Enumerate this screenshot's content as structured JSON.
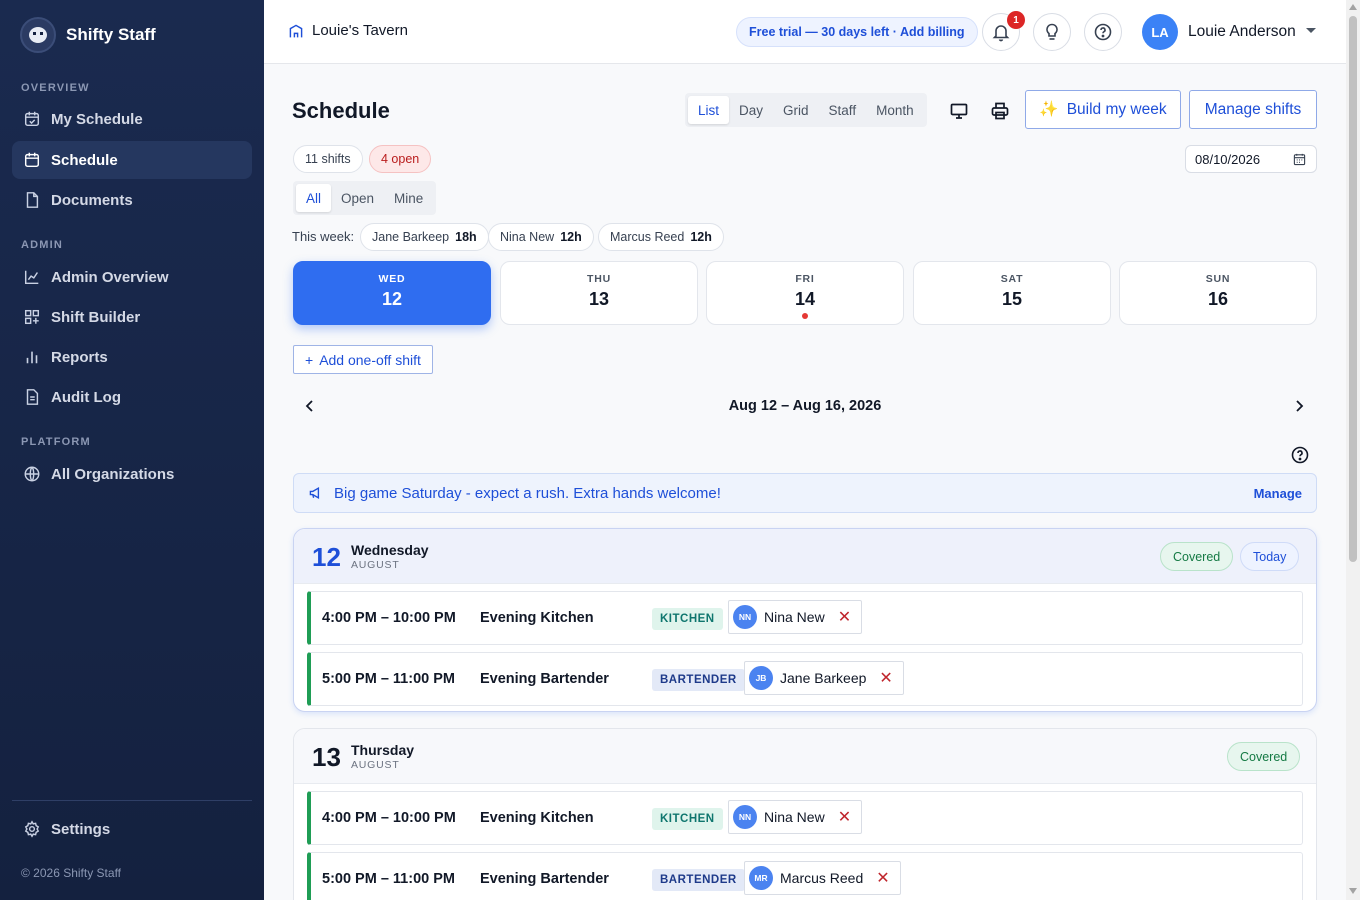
{
  "sidebar": {
    "brand": "Shifty Staff",
    "sections": {
      "overview": "OVERVIEW",
      "admin": "ADMIN",
      "platform": "PLATFORM"
    },
    "items": [
      {
        "label": "My Schedule",
        "icon": "calendar-check-icon"
      },
      {
        "label": "Schedule",
        "icon": "calendar-icon",
        "active": true
      },
      {
        "label": "Documents",
        "icon": "document-icon"
      },
      {
        "label": "Admin Overview",
        "icon": "line-chart-icon"
      },
      {
        "label": "Shift Builder",
        "icon": "grid-plus-icon"
      },
      {
        "label": "Reports",
        "icon": "bar-chart-icon"
      },
      {
        "label": "Audit Log",
        "icon": "file-list-icon"
      },
      {
        "label": "All Organizations",
        "icon": "globe-icon"
      }
    ],
    "settings": "Settings",
    "copyright": "© 2026 Shifty Staff"
  },
  "topbar": {
    "org_name": "Louie's Tavern",
    "trial": "Free trial — 30 days left · Add billing",
    "notifications_count": "1",
    "user_initials": "LA",
    "user_name": "Louie Anderson"
  },
  "schedule": {
    "title": "Schedule",
    "views": [
      "List",
      "Day",
      "Grid",
      "Staff",
      "Month"
    ],
    "active_view": "List",
    "build_week": "Build my week",
    "build_icon": "✨",
    "manage_shifts": "Manage shifts",
    "shift_count": "11 shifts",
    "open_count": "4 open",
    "date_value": "08/10/2026",
    "filters": [
      "All",
      "Open",
      "Mine"
    ],
    "active_filter": "All",
    "this_week_label": "This week:",
    "week_hours": [
      {
        "name": "Jane Barkeep",
        "hours": "18h"
      },
      {
        "name": "Nina New",
        "hours": "12h"
      },
      {
        "name": "Marcus Reed",
        "hours": "12h"
      }
    ],
    "days": [
      {
        "dow": "WED",
        "num": "12",
        "active": true
      },
      {
        "dow": "THU",
        "num": "13"
      },
      {
        "dow": "FRI",
        "num": "14",
        "dot": true
      },
      {
        "dow": "SAT",
        "num": "15"
      },
      {
        "dow": "SUN",
        "num": "16"
      }
    ],
    "add_shift": "Add one-off shift",
    "range": "Aug 12 – Aug 16, 2026",
    "announcement": "Big game Saturday - expect a rush. Extra hands welcome!",
    "announcement_manage": "Manage"
  },
  "day_blocks": [
    {
      "num": "12",
      "name": "Wednesday",
      "month": "AUGUST",
      "status": "Covered",
      "today": "Today",
      "shifts": [
        {
          "time": "4:00 PM – 10:00 PM",
          "title": "Evening Kitchen",
          "role": "KITCHEN",
          "initials": "NN",
          "assignee": "Nina New"
        },
        {
          "time": "5:00 PM – 11:00 PM",
          "title": "Evening Bartender",
          "role": "BARTENDER",
          "initials": "JB",
          "assignee": "Jane Barkeep"
        }
      ]
    },
    {
      "num": "13",
      "name": "Thursday",
      "month": "AUGUST",
      "status": "Covered",
      "shifts": [
        {
          "time": "4:00 PM – 10:00 PM",
          "title": "Evening Kitchen",
          "role": "KITCHEN",
          "initials": "NN",
          "assignee": "Nina New"
        },
        {
          "time": "5:00 PM – 11:00 PM",
          "title": "Evening Bartender",
          "role": "BARTENDER",
          "initials": "MR",
          "assignee": "Marcus Reed"
        }
      ]
    }
  ],
  "colors": {
    "sidebar_bg": "#1a2a4f",
    "accent": "#2f6df0",
    "covered": "#157a44",
    "danger": "#dc2626"
  }
}
